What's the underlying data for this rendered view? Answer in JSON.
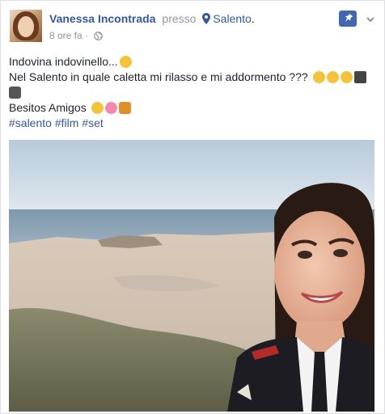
{
  "post": {
    "author": "Vanessa Incontrada",
    "presso": "presso",
    "place": "Salento",
    "time": "8 ore fa",
    "time_sep": "·",
    "lines": [
      "Indovina indovinello...",
      "Nel Salento in quale caletta mi rilasso e mi addormento ???",
      "Besitos Amigos"
    ],
    "hashtags": [
      "#salento",
      "#film",
      "#set"
    ]
  },
  "colors": {
    "link": "#365899",
    "muted": "#90949c",
    "pin_button": "#4267b2",
    "sky_top": "#c2d3e2",
    "sea": "#6f90a8",
    "sand": "#d8c8b7",
    "uniform": "#1c1c22"
  },
  "icons": {
    "place": "location-pin-icon",
    "privacy": "globe-icon",
    "pin": "pushpin-icon",
    "menu": "chevron-down-icon"
  }
}
